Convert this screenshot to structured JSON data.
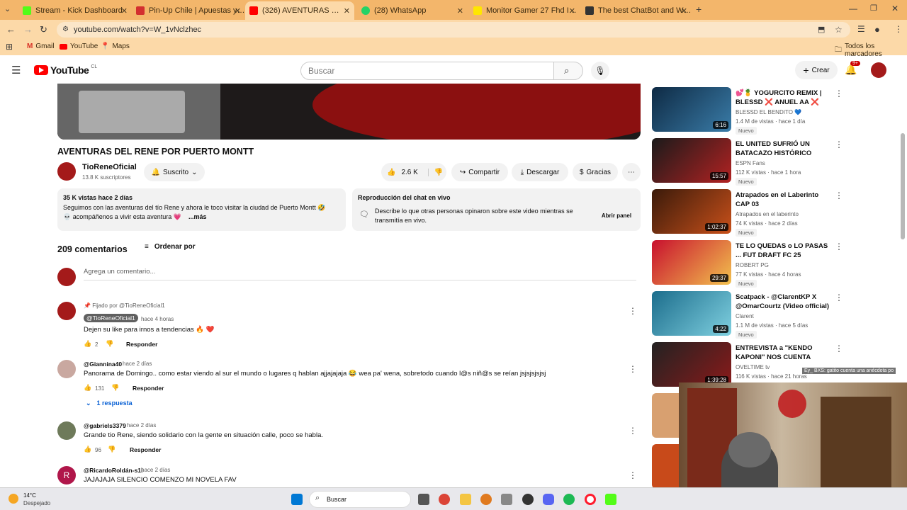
{
  "tabs": [
    {
      "label": "Stream - Kick Dashboard",
      "color": "#53fc18"
    },
    {
      "label": "Pin-Up Chile | Apuestas y Casino",
      "color": "#d32f2f"
    },
    {
      "label": "(326) AVENTURAS DEL RENE",
      "color": "#ff0000"
    },
    {
      "label": "(28) WhatsApp",
      "color": "#25d366"
    },
    {
      "label": "Monitor Gamer 27 Fhd Ips Hdr",
      "color": "#ffe600"
    },
    {
      "label": "The best ChatBot and Widgets",
      "color": "#333333"
    }
  ],
  "browser": {
    "url": "youtube.com/watch?v=W_1vNclzhec",
    "bookmarks": [
      "Gmail",
      "YouTube",
      "Maps"
    ],
    "all_bookmarks": "Todos los marcadores"
  },
  "yt": {
    "logo": "YouTube",
    "region": "CL",
    "search_placeholder": "Buscar",
    "create": "Crear",
    "notif_count": "9+"
  },
  "video": {
    "title": "AVENTURAS DEL RENE POR PUERTO MONTT",
    "channel": "TioReneOficial",
    "subs": "13.8 K suscriptores",
    "subscribed": "Suscrito",
    "likes": "2.6 K",
    "share": "Compartir",
    "download": "Descargar",
    "thanks": "Gracias",
    "desc_meta": "35 K vistas  hace 2 días",
    "desc_line1": "Seguimos con las aventuras del tío Rene y ahora le toco visitar la ciudad de Puerto Montt 🤣",
    "desc_line2": "💀 acompáñenos a vivir esta aventura 💗",
    "more": "...más",
    "chat_title": "Reproducción del chat en vivo",
    "chat_desc1": "Describe lo que otras personas opinaron sobre este video mientras se",
    "chat_desc2": "transmitía en vivo.",
    "open_panel": "Abrir panel"
  },
  "comments_header": {
    "count": "209 comentarios",
    "sort": "Ordenar por",
    "add": "Agrega un comentario..."
  },
  "comments": [
    {
      "pinned": "Fijado por @TioReneOficial1",
      "author": "@TioReneOficial1",
      "time": "hace 4 horas",
      "text": "Dejen su like para irnos a tendencias 🔥 ❤️",
      "likes": "2",
      "reply": "Responder"
    },
    {
      "author": "@Giannina40",
      "time": "hace 2 días",
      "text": "Panorama de Domingo..  como estar  viendo al sur el mundo o lugares q hablan ajjajajaja 😂 wea pa' wena, sobretodo cuando l@s niñ@s se reían jsjsjsjsjsj",
      "likes": "131",
      "reply": "Responder",
      "replies": "1 respuesta"
    },
    {
      "author": "@gabriels3379",
      "time": "hace 2 días",
      "text": "Grande tio Rene, siendo solidario con la gente en situación calle, poco se habla.",
      "likes": "96",
      "reply": "Responder"
    },
    {
      "author": "@RicardoRoldán-s1i",
      "time": "hace 2 días",
      "text": "JAJAJAJA SILENCIO COMENZO MI NOVELA FAV",
      "initial": "R"
    }
  ],
  "related": [
    {
      "title": "💕🍍 YOGURCITO REMIX | BLESSD ❌ ANUEL AA ❌ YA...",
      "channel": "BLESSD EL BENDITO 💙",
      "views": "1.4 M de vistas · hace 1 día",
      "dur": "6:16",
      "badge": "Nuevo",
      "c1": "#0e2a44",
      "c2": "#3a7ca8"
    },
    {
      "title": "EL UNITED SUFRIÓ UN BATACAZO HISTÓRICO ANTE ...",
      "channel": "ESPN Fans",
      "views": "112 K vistas · hace 1 hora",
      "dur": "15:57",
      "badge": "Nuevo",
      "c1": "#1a1a1a",
      "c2": "#b22222"
    },
    {
      "title": "Atrapados en el Laberinto CAP 03",
      "channel": "Atrapados en el laberinto",
      "views": "74 K vistas · hace 2 días",
      "dur": "1:02:37",
      "badge": "Nuevo",
      "c1": "#3a1a0a",
      "c2": "#c8501a"
    },
    {
      "title": "TE LO QUEDAS o LO PASAS ... FUT DRAFT FC 25",
      "channel": "ROBERT PG",
      "views": "77 K vistas · hace 4 horas",
      "dur": "29:37",
      "badge": "Nuevo",
      "c1": "#c8102e",
      "c2": "#f2c14e"
    },
    {
      "title": "Scatpack - @ClarentKP X @OmarCourtz (Video official)",
      "channel": "Clarent",
      "views": "1.1 M de vistas · hace 5 días",
      "dur": "4:22",
      "badge": "Nuevo",
      "c1": "#1c6d8c",
      "c2": "#7fd0e0"
    },
    {
      "title": "ENTREVISTA a \"KENDO KAPONI\" NOS CUENTA SOBRE...",
      "channel": "OVELTIME tv",
      "views": "116 K vistas · hace 21 horas",
      "dur": "1:39:28",
      "badge": "",
      "c1": "#222",
      "c2": "#8a1a1a"
    }
  ],
  "overlay": {
    "chat": "Ey_ BXS: gatito cuenta una anécdota po"
  },
  "taskbar": {
    "temp": "14°C",
    "weather": "Despejado",
    "search": "Buscar"
  }
}
